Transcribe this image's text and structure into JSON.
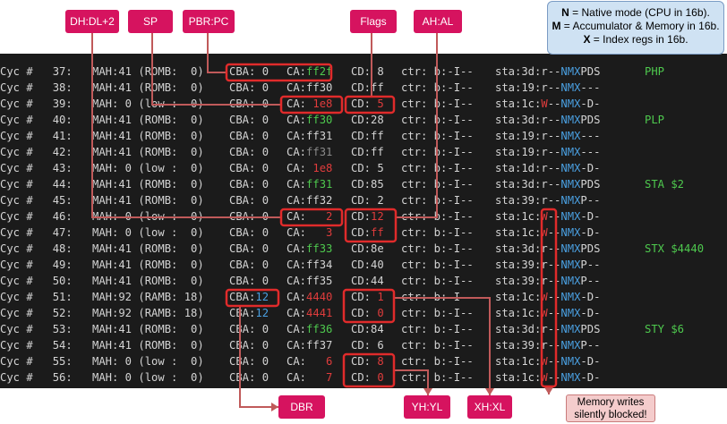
{
  "callouts": {
    "dhdl": "DH:DL+2",
    "sp": "SP",
    "pbrpc": "PBR:PC",
    "flags": "Flags",
    "ahal": "AH:AL",
    "dbr": "DBR",
    "yhyl": "YH:YL",
    "xhxl": "XH:XL"
  },
  "note": {
    "line1_key": "N",
    "line1_text": " = Native mode (CPU in 16b).",
    "line2_key": "M",
    "line2_text": " = Accumulator & Memory in 16b.",
    "line3_key": "X",
    "line3_text": " = Index regs in 16b."
  },
  "warning": {
    "line1": "Memory writes",
    "line2": "silently blocked!"
  },
  "colors": {
    "callout": "#d6135f",
    "highlight": "#e02b2b",
    "connector": "#c05a5a",
    "terminal_bg": "#1b1b1b",
    "green": "#4ec94e",
    "blue": "#4a9fe0",
    "red": "#e03c3c"
  },
  "trace": {
    "rows": [
      {
        "cyc": "37",
        "mah": "41",
        "mode": "(ROMB:  0)",
        "cba": "0",
        "ca": "ff2f",
        "cd": " 8",
        "ctr": "b:-I--",
        "sta": "3d",
        "flags": "r--NMXPDS",
        "instr": "PHP"
      },
      {
        "cyc": "38",
        "mah": "41",
        "mode": "(ROMB:  0)",
        "cba": "0",
        "ca": "ff30",
        "cd": "ff",
        "ctr": "b:-I--",
        "sta": "19",
        "flags": "r--NMX---",
        "instr": ""
      },
      {
        "cyc": "39",
        "mah": " 0",
        "mode": "(low :  0)",
        "cba": "0",
        "ca": " 1e8",
        "cd": " 5",
        "ctr": "b:-I--",
        "sta": "1c",
        "flags": "W--NMX-D-",
        "instr": ""
      },
      {
        "cyc": "40",
        "mah": "41",
        "mode": "(ROMB:  0)",
        "cba": "0",
        "ca": "ff30",
        "cd": "28",
        "ctr": "b:-I--",
        "sta": "3d",
        "flags": "r--NMXPDS",
        "instr": "PLP"
      },
      {
        "cyc": "41",
        "mah": "41",
        "mode": "(ROMB:  0)",
        "cba": "0",
        "ca": "ff31",
        "cd": "ff",
        "ctr": "b:-I--",
        "sta": "19",
        "flags": "r--NMX---",
        "instr": ""
      },
      {
        "cyc": "42",
        "mah": "41",
        "mode": "(ROMB:  0)",
        "cba": "0",
        "ca": "ff31",
        "cd": "ff",
        "ctr": "b:-I--",
        "sta": "19",
        "flags": "r--NMX---",
        "instr": ""
      },
      {
        "cyc": "43",
        "mah": " 0",
        "mode": "(low :  0)",
        "cba": "0",
        "ca": " 1e8",
        "cd": " 5",
        "ctr": "b:-I--",
        "sta": "1d",
        "flags": "r--NMX-D-",
        "instr": ""
      },
      {
        "cyc": "44",
        "mah": "41",
        "mode": "(ROMB:  0)",
        "cba": "0",
        "ca": "ff31",
        "cd": "85",
        "ctr": "b:-I--",
        "sta": "3d",
        "flags": "r--NMXPDS",
        "instr": "STA $2"
      },
      {
        "cyc": "45",
        "mah": "41",
        "mode": "(ROMB:  0)",
        "cba": "0",
        "ca": "ff32",
        "cd": " 2",
        "ctr": "b:-I--",
        "sta": "39",
        "flags": "r--NMXP--",
        "instr": ""
      },
      {
        "cyc": "46",
        "mah": " 0",
        "mode": "(low :  0)",
        "cba": "0",
        "ca": "   2",
        "cd": "12",
        "ctr": "b:-I--",
        "sta": "1c",
        "flags": "W--NMX-D-",
        "instr": ""
      },
      {
        "cyc": "47",
        "mah": " 0",
        "mode": "(low :  0)",
        "cba": "0",
        "ca": "   3",
        "cd": "ff",
        "ctr": "b:-I--",
        "sta": "1c",
        "flags": "W--NMX-D-",
        "instr": ""
      },
      {
        "cyc": "48",
        "mah": "41",
        "mode": "(ROMB:  0)",
        "cba": "0",
        "ca": "ff33",
        "cd": "8e",
        "ctr": "b:-I--",
        "sta": "3d",
        "flags": "r--NMXPDS",
        "instr": "STX $4440"
      },
      {
        "cyc": "49",
        "mah": "41",
        "mode": "(ROMB:  0)",
        "cba": "0",
        "ca": "ff34",
        "cd": "40",
        "ctr": "b:-I--",
        "sta": "39",
        "flags": "r--NMXP--",
        "instr": ""
      },
      {
        "cyc": "50",
        "mah": "41",
        "mode": "(ROMB:  0)",
        "cba": "0",
        "ca": "ff35",
        "cd": "44",
        "ctr": "b:-I--",
        "sta": "39",
        "flags": "r--NMXP--",
        "instr": ""
      },
      {
        "cyc": "51",
        "mah": "92",
        "mode": "(RAMB: 18)",
        "cba": "12",
        "ca": "4440",
        "cd": " 1",
        "ctr": "b:-I--",
        "sta": "1c",
        "flags": "W--NMX-D-",
        "instr": ""
      },
      {
        "cyc": "52",
        "mah": "92",
        "mode": "(RAMB: 18)",
        "cba": "12",
        "ca": "4441",
        "cd": " 0",
        "ctr": "b:-I--",
        "sta": "1c",
        "flags": "W--NMX-D-",
        "instr": ""
      },
      {
        "cyc": "53",
        "mah": "41",
        "mode": "(ROMB:  0)",
        "cba": "0",
        "ca": "ff36",
        "cd": "84",
        "ctr": "b:-I--",
        "sta": "3d",
        "flags": "r--NMXPDS",
        "instr": "STY $6"
      },
      {
        "cyc": "54",
        "mah": "41",
        "mode": "(ROMB:  0)",
        "cba": "0",
        "ca": "ff37",
        "cd": " 6",
        "ctr": "b:-I--",
        "sta": "39",
        "flags": "r--NMXP--",
        "instr": ""
      },
      {
        "cyc": "55",
        "mah": " 0",
        "mode": "(low :  0)",
        "cba": "0",
        "ca": "   6",
        "cd": " 8",
        "ctr": "b:-I--",
        "sta": "1c",
        "flags": "W--NMX-D-",
        "instr": ""
      },
      {
        "cyc": "56",
        "mah": " 0",
        "mode": "(low :  0)",
        "cba": "0",
        "ca": "   7",
        "cd": " 0",
        "ctr": "b:-I--",
        "sta": "1c",
        "flags": "W--NMX-D-",
        "instr": ""
      }
    ]
  }
}
